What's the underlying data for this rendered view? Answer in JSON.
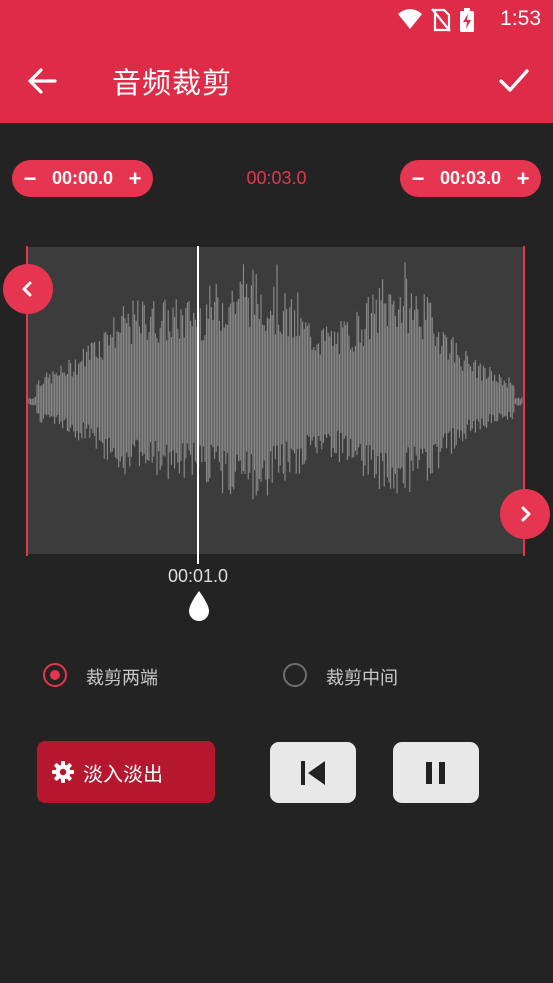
{
  "status_bar": {
    "time": "1:53",
    "icons": [
      "wifi-icon",
      "no-sim-icon",
      "battery-charging-icon"
    ]
  },
  "header": {
    "title": "音频裁剪",
    "back_icon": "arrow-left-icon",
    "confirm_icon": "check-icon"
  },
  "trim": {
    "start_time": "00:00.0",
    "duration": "00:03.0",
    "end_time": "00:03.0",
    "minus": "−",
    "plus": "+"
  },
  "waveform": {
    "playhead_time": "00:01.0",
    "playhead_position": 0.34
  },
  "modes": [
    {
      "label": "裁剪两端",
      "selected": true
    },
    {
      "label": "裁剪中间",
      "selected": false
    }
  ],
  "controls": {
    "fade_label": "淡入淡出",
    "fade_icon": "gear-icon",
    "skip_icon": "skip-start-icon",
    "pause_icon": "pause-icon"
  },
  "colors": {
    "accent": "#e63550",
    "header": "#de2b47",
    "background": "#232323",
    "fade_button": "#b5182e"
  }
}
